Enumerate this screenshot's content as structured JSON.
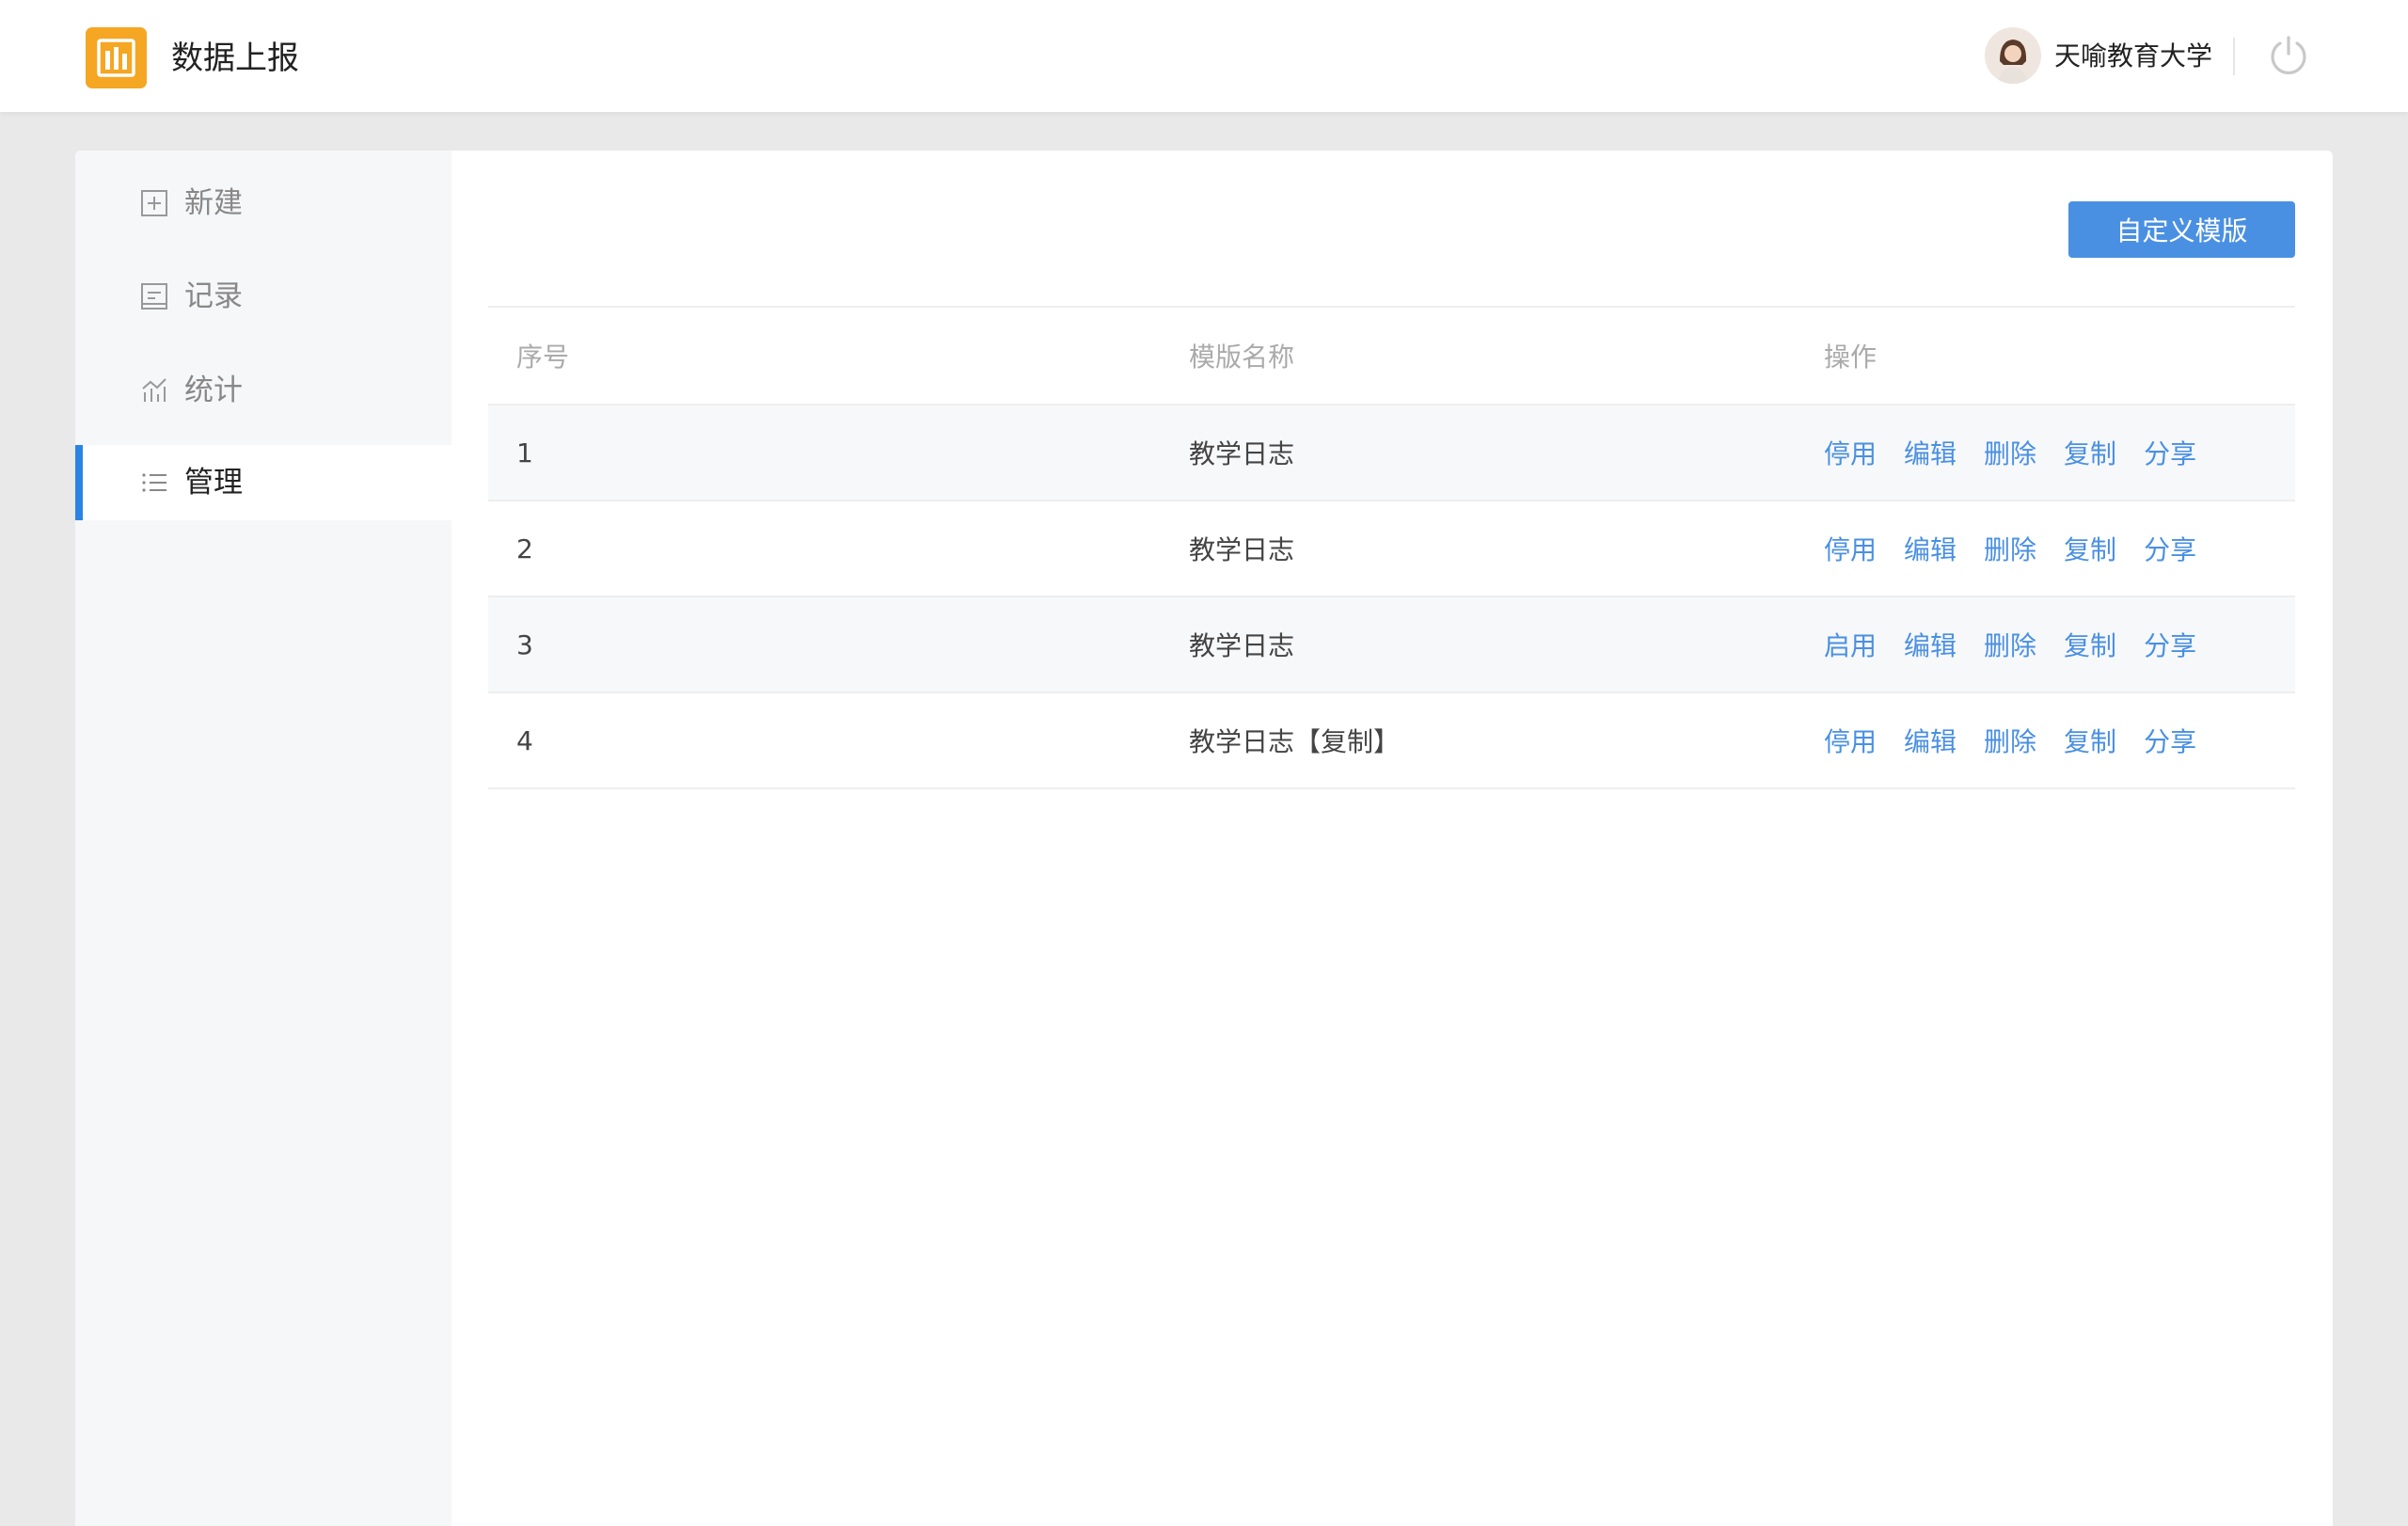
{
  "header": {
    "app_title": "数据上报",
    "user_name": "天喻教育大学"
  },
  "sidebar": {
    "items": [
      {
        "label": "新建",
        "icon": "plus-square-icon",
        "active": false
      },
      {
        "label": "记录",
        "icon": "document-icon",
        "active": false
      },
      {
        "label": "统计",
        "icon": "chart-icon",
        "active": false
      },
      {
        "label": "管理",
        "icon": "list-icon",
        "active": true
      }
    ]
  },
  "toolbar": {
    "custom_template_label": "自定义模版"
  },
  "table": {
    "columns": [
      "序号",
      "模版名称",
      "操作"
    ],
    "rows": [
      {
        "index": "1",
        "name": "教学日志",
        "actions": [
          "停用",
          "编辑",
          "删除",
          "复制",
          "分享"
        ]
      },
      {
        "index": "2",
        "name": "教学日志",
        "actions": [
          "停用",
          "编辑",
          "删除",
          "复制",
          "分享"
        ]
      },
      {
        "index": "3",
        "name": "教学日志",
        "actions": [
          "启用",
          "编辑",
          "删除",
          "复制",
          "分享"
        ]
      },
      {
        "index": "4",
        "name": "教学日志【复制】",
        "actions": [
          "停用",
          "编辑",
          "删除",
          "复制",
          "分享"
        ]
      }
    ]
  },
  "colors": {
    "brand": "#f5a623",
    "accent": "#4a90e2",
    "active_bar": "#2a84e3"
  }
}
